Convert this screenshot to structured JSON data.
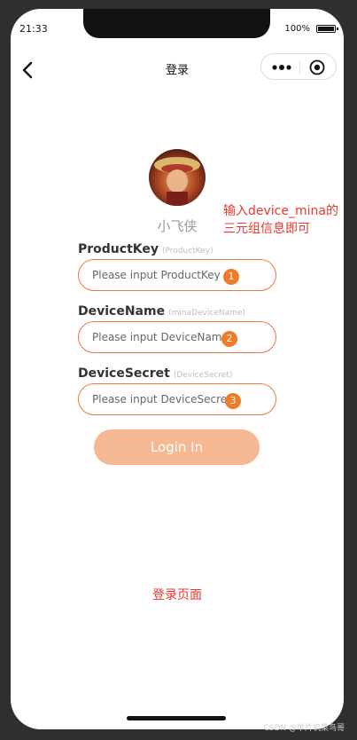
{
  "status_bar": {
    "time": "21:33",
    "battery": "100%"
  },
  "nav": {
    "title": "登录"
  },
  "profile": {
    "username": "小飞侠"
  },
  "annotation": {
    "text": "输入device_mina的三元组信息即可"
  },
  "fields": [
    {
      "label": "ProductKey",
      "hint": "(ProductKey)",
      "placeholder": "Please input ProductKey",
      "badge": "1"
    },
    {
      "label": "DeviceName",
      "hint": "(minaDeviceName)",
      "placeholder": "Please input DeviceName",
      "badge": "2"
    },
    {
      "label": "DeviceSecret",
      "hint": "(DeviceSecret)",
      "placeholder": "Please input DeviceSecret",
      "badge": "3"
    }
  ],
  "login_button": {
    "label": "Login In"
  },
  "caption": {
    "text": "登录页面"
  },
  "watermark": {
    "text": "CSDN @单片机菜鸟哥"
  },
  "colors": {
    "accent": "#f07c2a",
    "button": "#f5b893",
    "annotation": "#e8382f"
  }
}
